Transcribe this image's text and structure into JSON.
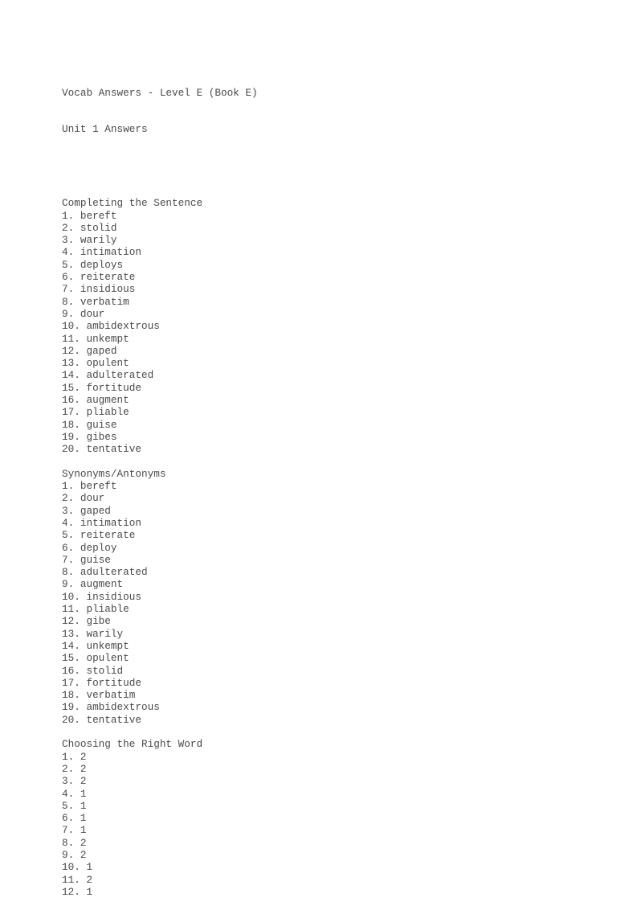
{
  "document": {
    "title": "Vocab Answers - Level E (Book E)",
    "subtitle": "Unit 1 Answers",
    "sections": [
      {
        "heading": "Completing the Sentence",
        "items": [
          "1. bereft",
          "2. stolid",
          "3. warily",
          "4. intimation",
          "5. deploys",
          "6. reiterate",
          "7. insidious",
          "8. verbatim",
          "9. dour",
          "10. ambidextrous",
          "11. unkempt",
          "12. gaped",
          "13. opulent",
          "14. adulterated",
          "15. fortitude",
          "16. augment",
          "17. pliable",
          "18. guise",
          "19. gibes",
          "20. tentative"
        ]
      },
      {
        "heading": "Synonyms/Antonyms",
        "items": [
          "1. bereft",
          "2. dour",
          "3. gaped",
          "4. intimation",
          "5. reiterate",
          "6. deploy",
          "7. guise",
          "8. adulterated",
          "9. augment",
          "10. insidious",
          "11. pliable",
          "12. gibe",
          "13. warily",
          "14. unkempt",
          "15. opulent",
          "16. stolid",
          "17. fortitude",
          "18. verbatim",
          "19. ambidextrous",
          "20. tentative"
        ]
      },
      {
        "heading": "Choosing the Right Word",
        "items": [
          "1. 2",
          "2. 2",
          "3. 2",
          "4. 1",
          "5. 1",
          "6. 1",
          "7. 1",
          "8. 2",
          "9. 2",
          "10. 1",
          "11. 2",
          "12. 1"
        ]
      }
    ]
  }
}
